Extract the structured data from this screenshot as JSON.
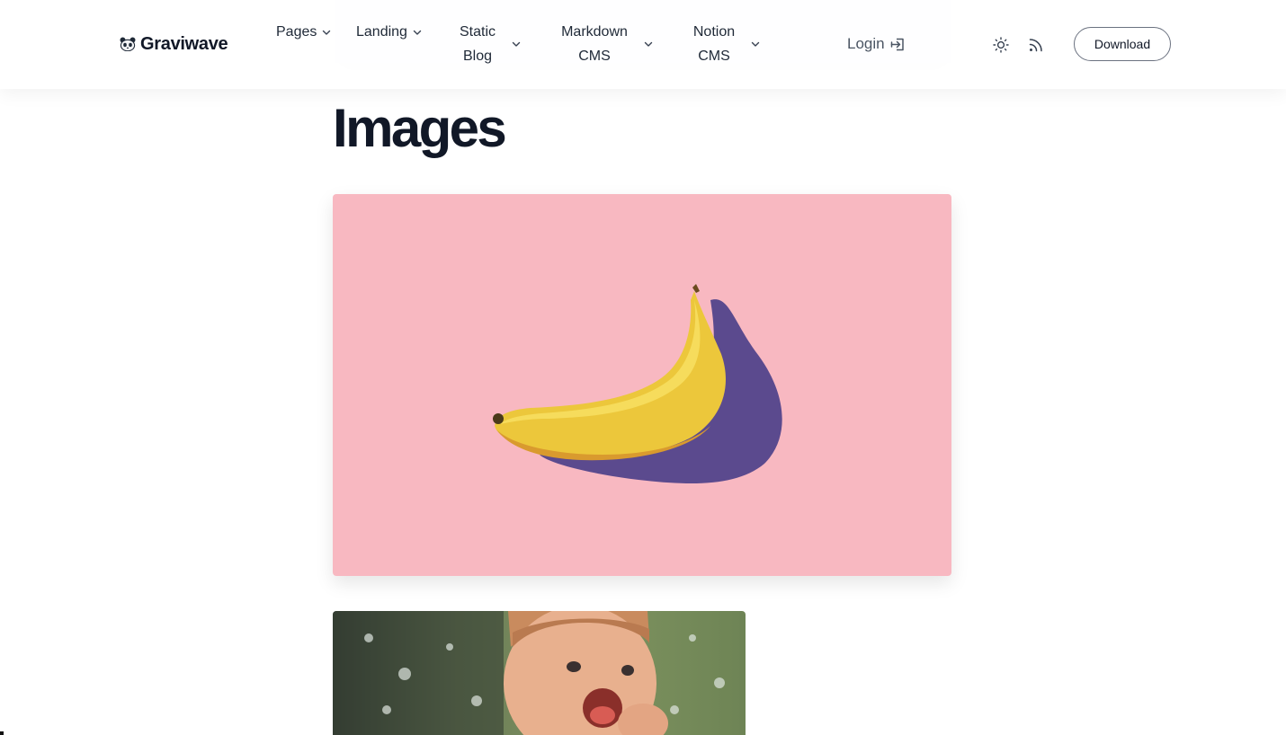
{
  "header": {
    "brand": "Graviwave",
    "brand_icon": "panda-icon",
    "nav": [
      {
        "label": "Pages",
        "icon": "chevron-down-icon"
      },
      {
        "label": "Landing",
        "icon": "chevron-down-icon"
      },
      {
        "label": "Static Blog",
        "icon": "chevron-down-icon"
      },
      {
        "label": "Markdown CMS",
        "icon": "chevron-down-icon"
      },
      {
        "label": "Notion CMS",
        "icon": "chevron-down-icon"
      }
    ],
    "login_label": "Login",
    "login_icon": "login-icon",
    "theme_icon": "sun-icon",
    "rss_icon": "rss-icon",
    "download_label": "Download"
  },
  "main": {
    "title": "Images",
    "images": [
      {
        "subject": "banana on pink background",
        "background_color": "#f8b8c1"
      },
      {
        "subject": "laughing child in water spray"
      }
    ]
  },
  "colors": {
    "text": "#111827",
    "border": "#6b7280",
    "header_bg": "#ffffff"
  }
}
